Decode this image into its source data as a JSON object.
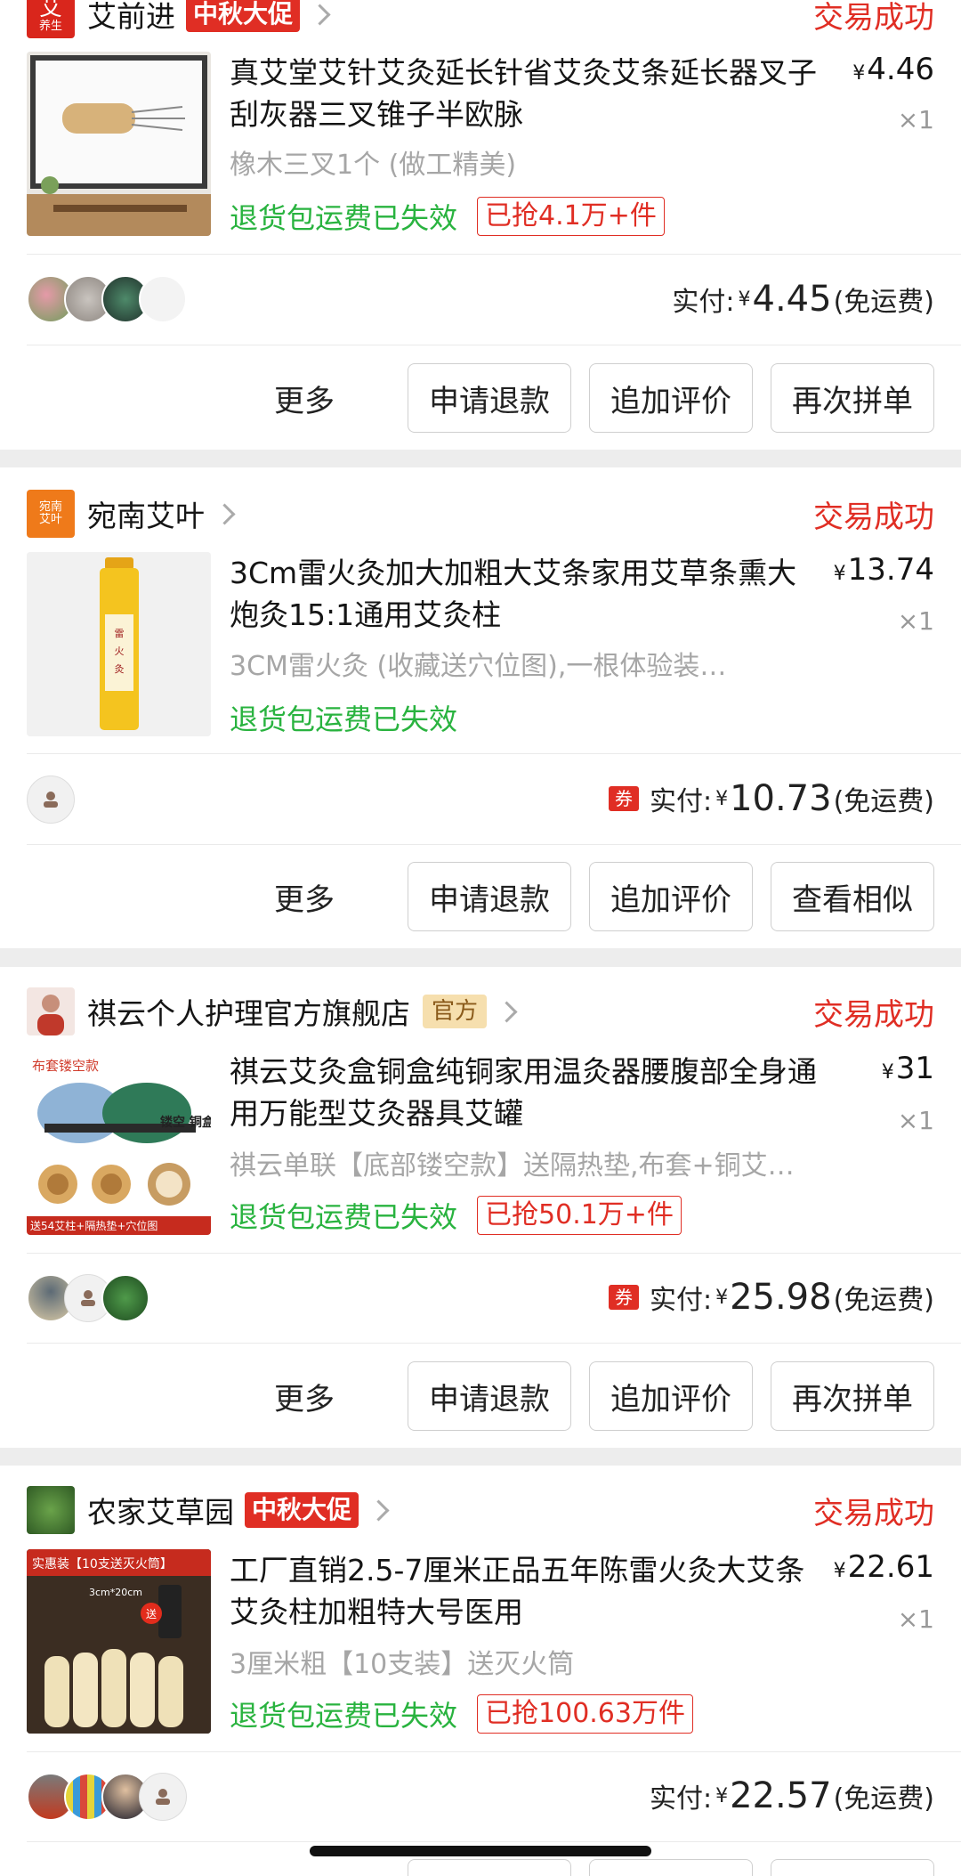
{
  "orders": [
    {
      "shop": {
        "name": "艾前进",
        "logo_text": "艾",
        "logo_sub": "养生",
        "promo": "中秋大促"
      },
      "status": "交易成功",
      "product": {
        "title": "真艾堂艾针艾灸延长针省艾灸艾条延长器叉子刮灰器三叉锥子半欧脉",
        "price": "4.46",
        "qty": "×1",
        "spec": "橡木三叉1个 (做工精美)",
        "return_note": "退货包运费已失效",
        "grab": "已抢4.1万+件"
      },
      "paid": {
        "label": "实付:",
        "amount": "4.45",
        "shipping": "(免运费)",
        "coupon": ""
      },
      "actions": {
        "more": "更多",
        "buttons": [
          "申请退款",
          "追加评价",
          "再次拼单"
        ]
      }
    },
    {
      "shop": {
        "name": "宛南艾叶",
        "logo_text": "宛南",
        "logo_sub": "艾叶",
        "promo": ""
      },
      "status": "交易成功",
      "product": {
        "title": "3Cm雷火灸加大加粗大艾条家用艾草条熏大炮灸15:1通用艾灸柱",
        "price": "13.74",
        "qty": "×1",
        "spec": "3CM雷火灸 (收藏送穴位图),一根体验装…",
        "return_note": "退货包运费已失效",
        "grab": ""
      },
      "paid": {
        "label": "实付:",
        "amount": "10.73",
        "shipping": "(免运费)",
        "coupon": "券"
      },
      "actions": {
        "more": "更多",
        "buttons": [
          "申请退款",
          "追加评价",
          "查看相似"
        ]
      }
    },
    {
      "shop": {
        "name": "祺云个人护理官方旗舰店",
        "official": "官方",
        "promo": ""
      },
      "status": "交易成功",
      "product": {
        "title": "祺云艾灸盒铜盒纯铜家用温灸器腰腹部全身通用万能型艾灸器具艾罐",
        "price": "31",
        "qty": "×1",
        "spec": "祺云单联【底部镂空款】送隔热垫,布套+铜艾…",
        "return_note": "退货包运费已失效",
        "grab": "已抢50.1万+件"
      },
      "paid": {
        "label": "实付:",
        "amount": "25.98",
        "shipping": "(免运费)",
        "coupon": "券"
      },
      "actions": {
        "more": "更多",
        "buttons": [
          "申请退款",
          "追加评价",
          "再次拼单"
        ]
      }
    },
    {
      "shop": {
        "name": "农家艾草园",
        "promo": "中秋大促"
      },
      "status": "交易成功",
      "product": {
        "title": "工厂直销2.5-7厘米正品五年陈雷火灸大艾条艾灸柱加粗特大号医用",
        "price": "22.61",
        "qty": "×1",
        "spec": "3厘米粗【10支装】送灭火筒",
        "return_note": "退货包运费已失效",
        "grab": "已抢100.63万件"
      },
      "paid": {
        "label": "实付:",
        "amount": "22.57",
        "shipping": "(免运费)",
        "coupon": ""
      }
    }
  ],
  "thumb_texts": {
    "o2": "雷火灸",
    "o3_top": "布套镂空款",
    "o3_side": "镂空 铜盒",
    "o3_bottom": "送54艾柱+隔热垫+穴位图",
    "o4_top": "实惠装【10支送灭火筒】",
    "o4_size": "3cm*20cm",
    "o4_badge": "送"
  },
  "currency": "¥",
  "colors": {
    "accent": "#e02e24",
    "green": "#29b33f",
    "muted": "#a6a6a6"
  }
}
